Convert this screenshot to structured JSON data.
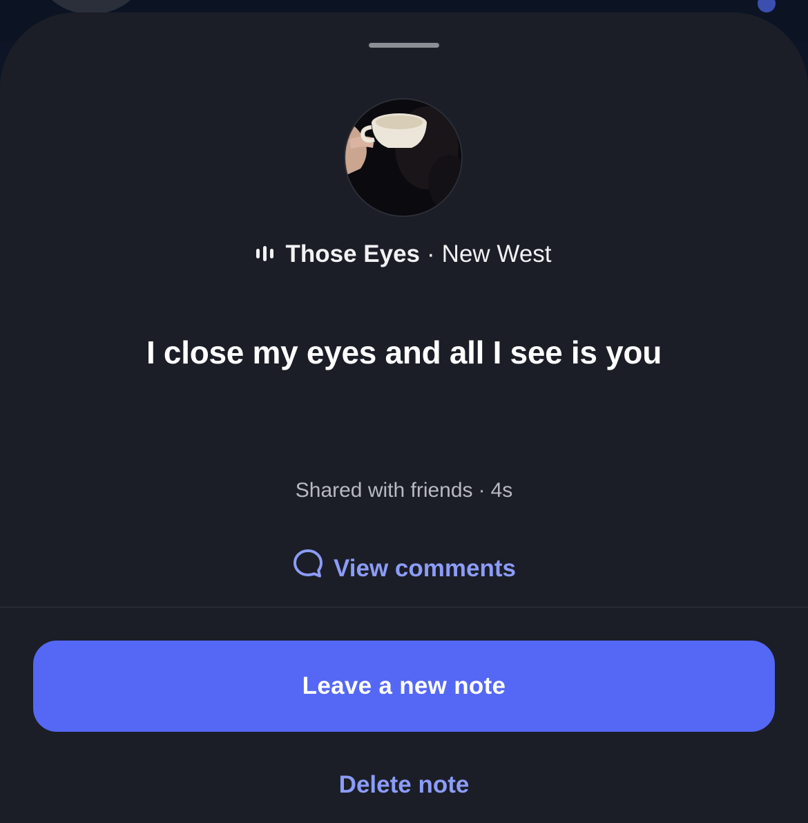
{
  "note": {
    "music": {
      "icon": "music-bars-icon",
      "song": "Those Eyes",
      "separator": "·",
      "artist": "New West"
    },
    "text": "I close my eyes and all I see is you",
    "audience": "Shared with friends",
    "meta_separator": "·",
    "age": "4s",
    "view_comments_label": "View comments"
  },
  "actions": {
    "primary_label": "Leave a new note",
    "delete_label": "Delete note"
  },
  "colors": {
    "sheet_bg": "#1b1e27",
    "accent": "#5468f5",
    "link": "#8c9cf7"
  }
}
